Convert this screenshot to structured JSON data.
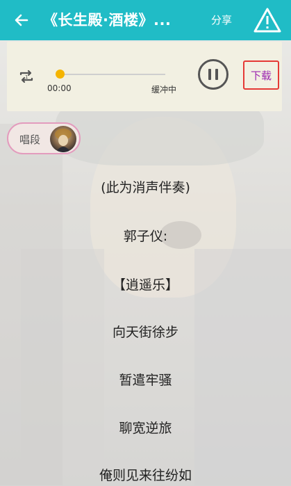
{
  "header": {
    "title": "《长生殿·酒楼》...",
    "share_label": "分享",
    "colors": {
      "bar": "#20bcc6",
      "text": "#ffffff"
    },
    "icons": {
      "back": "arrow-left-icon",
      "alert": "warning-triangle-icon"
    }
  },
  "player": {
    "elapsed": "00:00",
    "status": "缓冲中",
    "progress": 0,
    "download_label": "下载",
    "icons": {
      "repeat": "repeat-one-icon",
      "play_state": "pause-icon"
    },
    "colors": {
      "knob": "#f5b400",
      "download_border": "#e53935",
      "download_text": "#9c27b0"
    }
  },
  "segment": {
    "label": "唱段",
    "avatar_icon": "performer-avatar"
  },
  "lyrics": [
    "(此为消声伴奏)",
    "郭子仪:",
    "【逍遥乐】",
    "向天街徐步",
    "暂遣牢骚",
    "聊宽逆旅",
    "俺则见来往纷如"
  ]
}
